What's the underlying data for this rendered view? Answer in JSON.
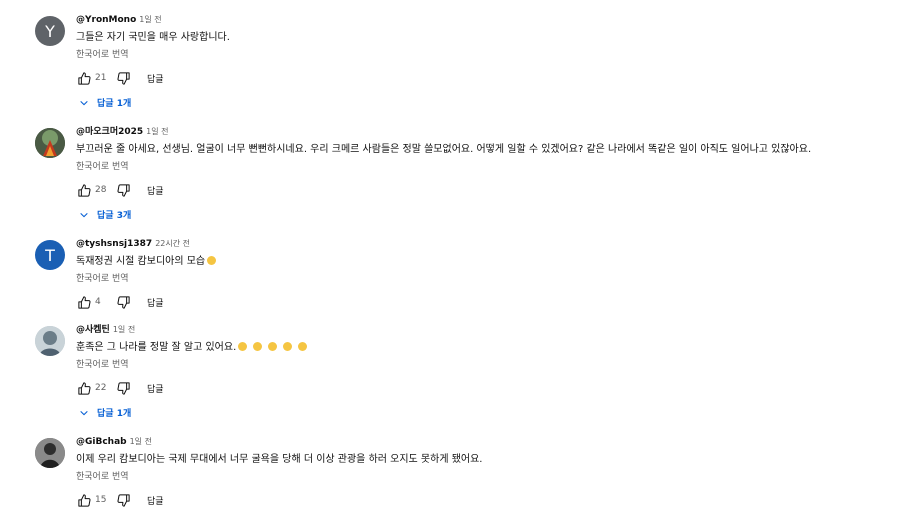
{
  "comments": [
    {
      "author": "@YronMono",
      "time": "1일 전",
      "text": "그들은 자기 국민을 매우 사랑합니다.",
      "translate": "한국어로 번역",
      "likes": "21",
      "reply_label": "답글",
      "replies_label": "답글 1개",
      "avatar_letter": "Y",
      "avatar_color": "#5f6368"
    },
    {
      "author": "@마오크머2025",
      "time": "1일 전",
      "text": "부끄러운 줄 아세요, 선생님. 얼굴이 너무 뻔뻔하시네요. 우리 크메르 사람들은 정말 쓸모없어요. 어떻게 일할 수 있겠어요? 같은 나라에서 똑같은 일이 아직도 일어나고 있잖아요.",
      "translate": "한국어로 번역",
      "likes": "28",
      "reply_label": "답글",
      "replies_label": "답글 3개"
    },
    {
      "author": "@tyshsnsj1387",
      "time": "22시간 전",
      "text": "독재정권 시절 캄보디아의 모습",
      "translate": "한국어로 번역",
      "likes": "4",
      "reply_label": "답글",
      "avatar_letter": "T",
      "avatar_color": "#1a5fb4"
    },
    {
      "author": "@사켐틴",
      "time": "1일 전",
      "text": "훈족은 그 나라를 정말 잘 알고 있어요.",
      "translate": "한국어로 번역",
      "likes": "22",
      "reply_label": "답글",
      "replies_label": "답글 1개"
    },
    {
      "author": "@GiBchab",
      "time": "1일 전",
      "text": "이제 우리 캄보디아는 국제 무대에서 너무 굴욕을 당해 더 이상 관광을 하러 오지도 못하게 됐어요.",
      "translate": "한국어로 번역",
      "likes": "15",
      "reply_label": "답글"
    }
  ],
  "colors": {
    "link_blue": "#065fd4",
    "secondary_text": "#606060",
    "primary_text": "#0f0f0f"
  },
  "icons": {
    "like": "thumb-up-icon",
    "dislike": "thumb-down-icon",
    "replies_toggle": "chevron-down-icon",
    "sad_emoji": "sad-face-emoji",
    "laugh_emoji": "laughing-face-emoji"
  }
}
